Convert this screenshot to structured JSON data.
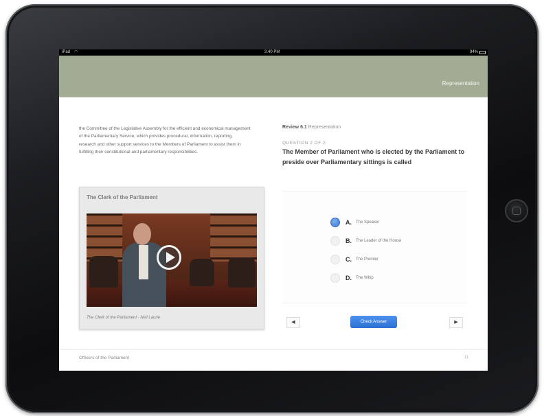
{
  "status_bar": {
    "device": "iPad",
    "wifi_icon": "wifi-icon",
    "time": "3:40 PM",
    "battery": "94%",
    "battery_icon": "battery-icon"
  },
  "header": {
    "title": "Representation"
  },
  "left": {
    "body_text": "the Committee of the Legislative Assembly for the efficient and economical management of the Parliamentary Service, which provides procedural, information, reporting, research and other support services to the Members of Parliament to assist them in fulfilling their constitutional and parliamentary responsibilities.",
    "video": {
      "title": "The Clerk of the Parliament",
      "caption": "The Clerk of the Parliament - Neil Laurie",
      "play_icon": "play-icon"
    }
  },
  "review": {
    "label": "Review 6.1",
    "section": "Representation",
    "counter": "QUESTION 2 OF 2",
    "question": "The Member of Parliament who is elected by the Parliament to preside over Parliamentary sittings is called",
    "options": [
      {
        "letter": "A.",
        "text": "The Speaker",
        "selected": true
      },
      {
        "letter": "B.",
        "text": "The Leader of the House",
        "selected": false
      },
      {
        "letter": "C.",
        "text": "The Premier",
        "selected": false
      },
      {
        "letter": "D.",
        "text": "The Whip",
        "selected": false
      }
    ],
    "prev_icon": "◀",
    "next_icon": "▶",
    "check_label": "Check Answer",
    "accent": "#3a74cf"
  },
  "footer": {
    "chapter": "Officers of the Parliament",
    "page": "11"
  }
}
